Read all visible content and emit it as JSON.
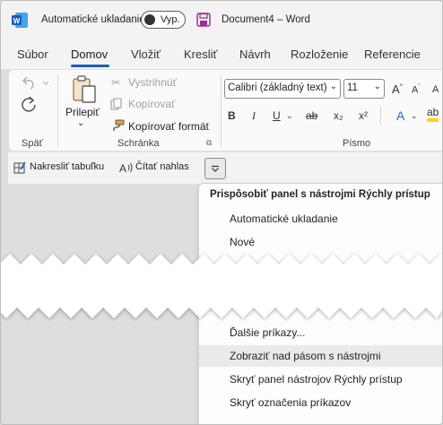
{
  "titlebar": {
    "autosave_label": "Automatické ukladanie",
    "autosave_toggle": "Vyp.",
    "doc_title": "Document4 – Word"
  },
  "tabs": [
    {
      "label": "Súbor"
    },
    {
      "label": "Domov",
      "active": true
    },
    {
      "label": "Vložiť"
    },
    {
      "label": "Kresliť"
    },
    {
      "label": "Návrh"
    },
    {
      "label": "Rozloženie"
    },
    {
      "label": "Referencie"
    }
  ],
  "ribbon": {
    "undo_group_label": "Späť",
    "paste_label": "Prilepiť",
    "cut_label": "Vystrihnúť",
    "copy_label": "Kopírovať",
    "format_painter_label": "Kopírovať formát",
    "clipboard_group_label": "Schránka",
    "font_name": "Calibri (základný text)",
    "font_size": "11",
    "font_group_label": "Písmo",
    "format_buttons": [
      "B",
      "I",
      "U",
      "ab",
      "x₂",
      "x²"
    ]
  },
  "qat": {
    "draw_table_label": "Nakresliť tabuľku",
    "read_aloud_label": "Čítať nahlas"
  },
  "menu": {
    "header": "Prispôsobiť panel s nástrojmi Rýchly prístup",
    "items_top": [
      "Automatické ukladanie",
      "Nové"
    ],
    "items_bottom": [
      {
        "label": "Ďalšie príkazy..."
      },
      {
        "label": "Zobraziť nad pásom s nástrojmi",
        "highlighted": true
      },
      {
        "label": "Skryť panel nástrojov Rýchly prístup"
      },
      {
        "label": "Skryť označenia príkazov"
      }
    ]
  },
  "colors": {
    "accent": "#1a5fb4",
    "word_blue": "#185abd",
    "save_purple": "#a02b93"
  }
}
